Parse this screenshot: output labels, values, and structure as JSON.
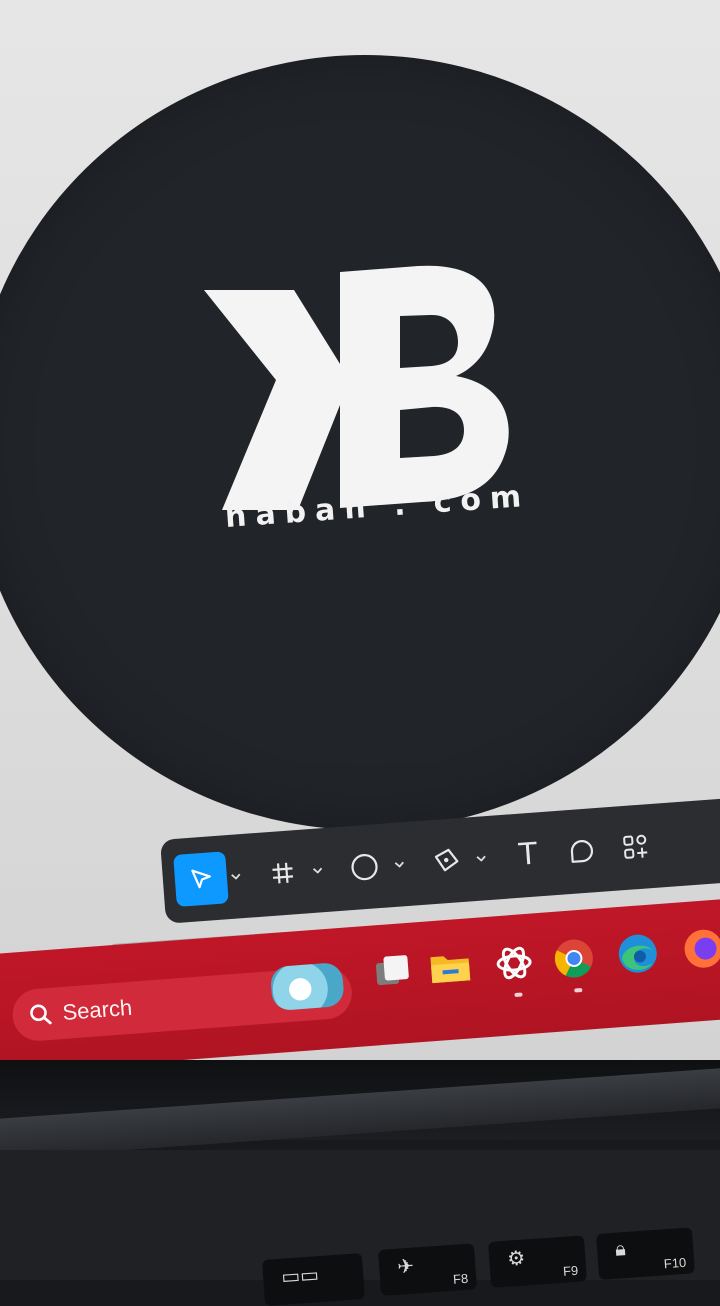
{
  "logo": {
    "monogram": "KB",
    "domain": "haban . com"
  },
  "toolbar": {
    "tools": [
      {
        "name": "move",
        "icon": "cursor-arrow-icon",
        "active": true,
        "has_menu": true
      },
      {
        "name": "frame",
        "icon": "frame-hash-icon",
        "has_menu": true
      },
      {
        "name": "ellipse",
        "icon": "ellipse-icon",
        "has_menu": true
      },
      {
        "name": "pen",
        "icon": "pen-icon",
        "has_menu": true
      },
      {
        "name": "text",
        "icon": "text-icon",
        "label": "T"
      },
      {
        "name": "comment",
        "icon": "comment-icon"
      },
      {
        "name": "actions",
        "icon": "actions-grid-icon"
      }
    ],
    "colors": {
      "bar": "#2b2d31",
      "active": "#0d99ff"
    }
  },
  "taskbar": {
    "search_label": "Search",
    "apps": [
      "widgets-weather-icon",
      "task-view-icon",
      "file-explorer-icon",
      "chatgpt-icon",
      "chrome-icon",
      "edge-icon",
      "firefox-icon"
    ],
    "color": "#c01728"
  },
  "keyboard": {
    "keys": [
      {
        "label": "",
        "icon": "display-mode-icon"
      },
      {
        "label": "F8",
        "icon": "airplane-icon"
      },
      {
        "label": "F9",
        "icon": "settings-gear-icon"
      },
      {
        "label": "F10",
        "icon": "lock-icon"
      }
    ]
  }
}
